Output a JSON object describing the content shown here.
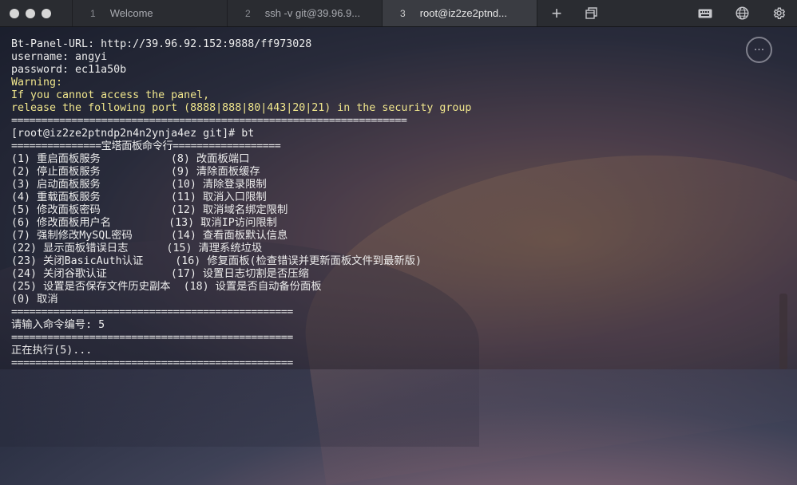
{
  "tabs": [
    {
      "num": "1",
      "label": "Welcome"
    },
    {
      "num": "2",
      "label": "ssh -v git@39.96.9..."
    },
    {
      "num": "3",
      "label": "root@iz2ze2ptnd..."
    }
  ],
  "toolbar": {
    "new_tab": "+",
    "more_icon": "···"
  },
  "terminal": {
    "lines": [
      "Bt-Panel-URL: http://39.96.92.152:9888/ff973028",
      "username: angyi",
      "password: ec11a50b",
      "Warning:",
      "If you cannot access the panel,",
      "release the following port (8888|888|80|443|20|21) in the security group",
      "==================================================================",
      "[root@iz2ze2ptndp2n4n2ynja4ez git]# bt",
      "===============宝塔面板命令行==================",
      "(1) 重启面板服务           (8) 改面板端口",
      "(2) 停止面板服务           (9) 清除面板缓存",
      "(3) 启动面板服务           (10) 清除登录限制",
      "(4) 重载面板服务           (11) 取消入口限制",
      "(5) 修改面板密码           (12) 取消域名绑定限制",
      "(6) 修改面板用户名         (13) 取消IP访问限制",
      "(7) 强制修改MySQL密码      (14) 查看面板默认信息",
      "(22) 显示面板错误日志      (15) 清理系统垃圾",
      "(23) 关闭BasicAuth认证     (16) 修复面板(检查错误并更新面板文件到最新版)",
      "(24) 关闭谷歌认证          (17) 设置日志切割是否压缩",
      "(25) 设置是否保存文件历史副本  (18) 设置是否自动备份面板",
      "(0) 取消",
      "===============================================",
      "请输入命令编号: 5",
      "===============================================",
      "正在执行(5)...",
      "==============================================="
    ]
  }
}
